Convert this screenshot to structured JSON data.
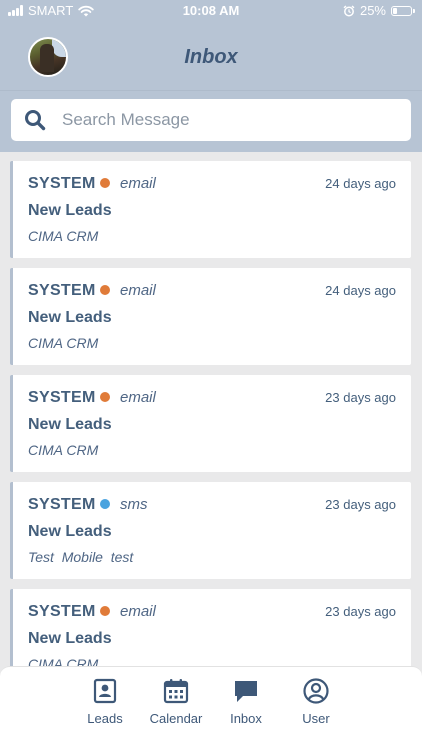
{
  "status_bar": {
    "carrier": "SMART",
    "time": "10:08 AM",
    "battery": "25%",
    "battery_level": 0.25,
    "icons": [
      "signal-icon",
      "wifi-icon",
      "alarm-icon",
      "battery-icon"
    ]
  },
  "header": {
    "title": "Inbox",
    "avatar": "user-avatar"
  },
  "search": {
    "placeholder": "Search Message",
    "value": ""
  },
  "colors": {
    "header_bg": "#b7c4d4",
    "text": "#445f7c",
    "email_dot": "#e07b39",
    "sms_dot": "#4aa3df",
    "page_bg": "#e9e9ea"
  },
  "messages": [
    {
      "sender": "SYSTEM",
      "channel": "email",
      "dot_color": "#e07b39",
      "time": "24 days ago",
      "subject": "New Leads",
      "preview": "CIMA CRM"
    },
    {
      "sender": "SYSTEM",
      "channel": "email",
      "dot_color": "#e07b39",
      "time": "24 days ago",
      "subject": "New Leads",
      "preview": "CIMA CRM"
    },
    {
      "sender": "SYSTEM",
      "channel": "email",
      "dot_color": "#e07b39",
      "time": "23 days ago",
      "subject": "New Leads",
      "preview": "CIMA CRM"
    },
    {
      "sender": "SYSTEM",
      "channel": "sms",
      "dot_color": "#4aa3df",
      "time": "23 days ago",
      "subject": "New Leads",
      "preview": "Test  Mobile  test"
    },
    {
      "sender": "SYSTEM",
      "channel": "email",
      "dot_color": "#e07b39",
      "time": "23 days ago",
      "subject": "New Leads",
      "preview": "CIMA CRM"
    }
  ],
  "nav": {
    "items": [
      {
        "label": "Leads",
        "icon": "contact-card-icon"
      },
      {
        "label": "Calendar",
        "icon": "calendar-icon"
      },
      {
        "label": "Inbox",
        "icon": "chat-bubble-icon"
      },
      {
        "label": "User",
        "icon": "user-circle-icon"
      }
    ]
  }
}
